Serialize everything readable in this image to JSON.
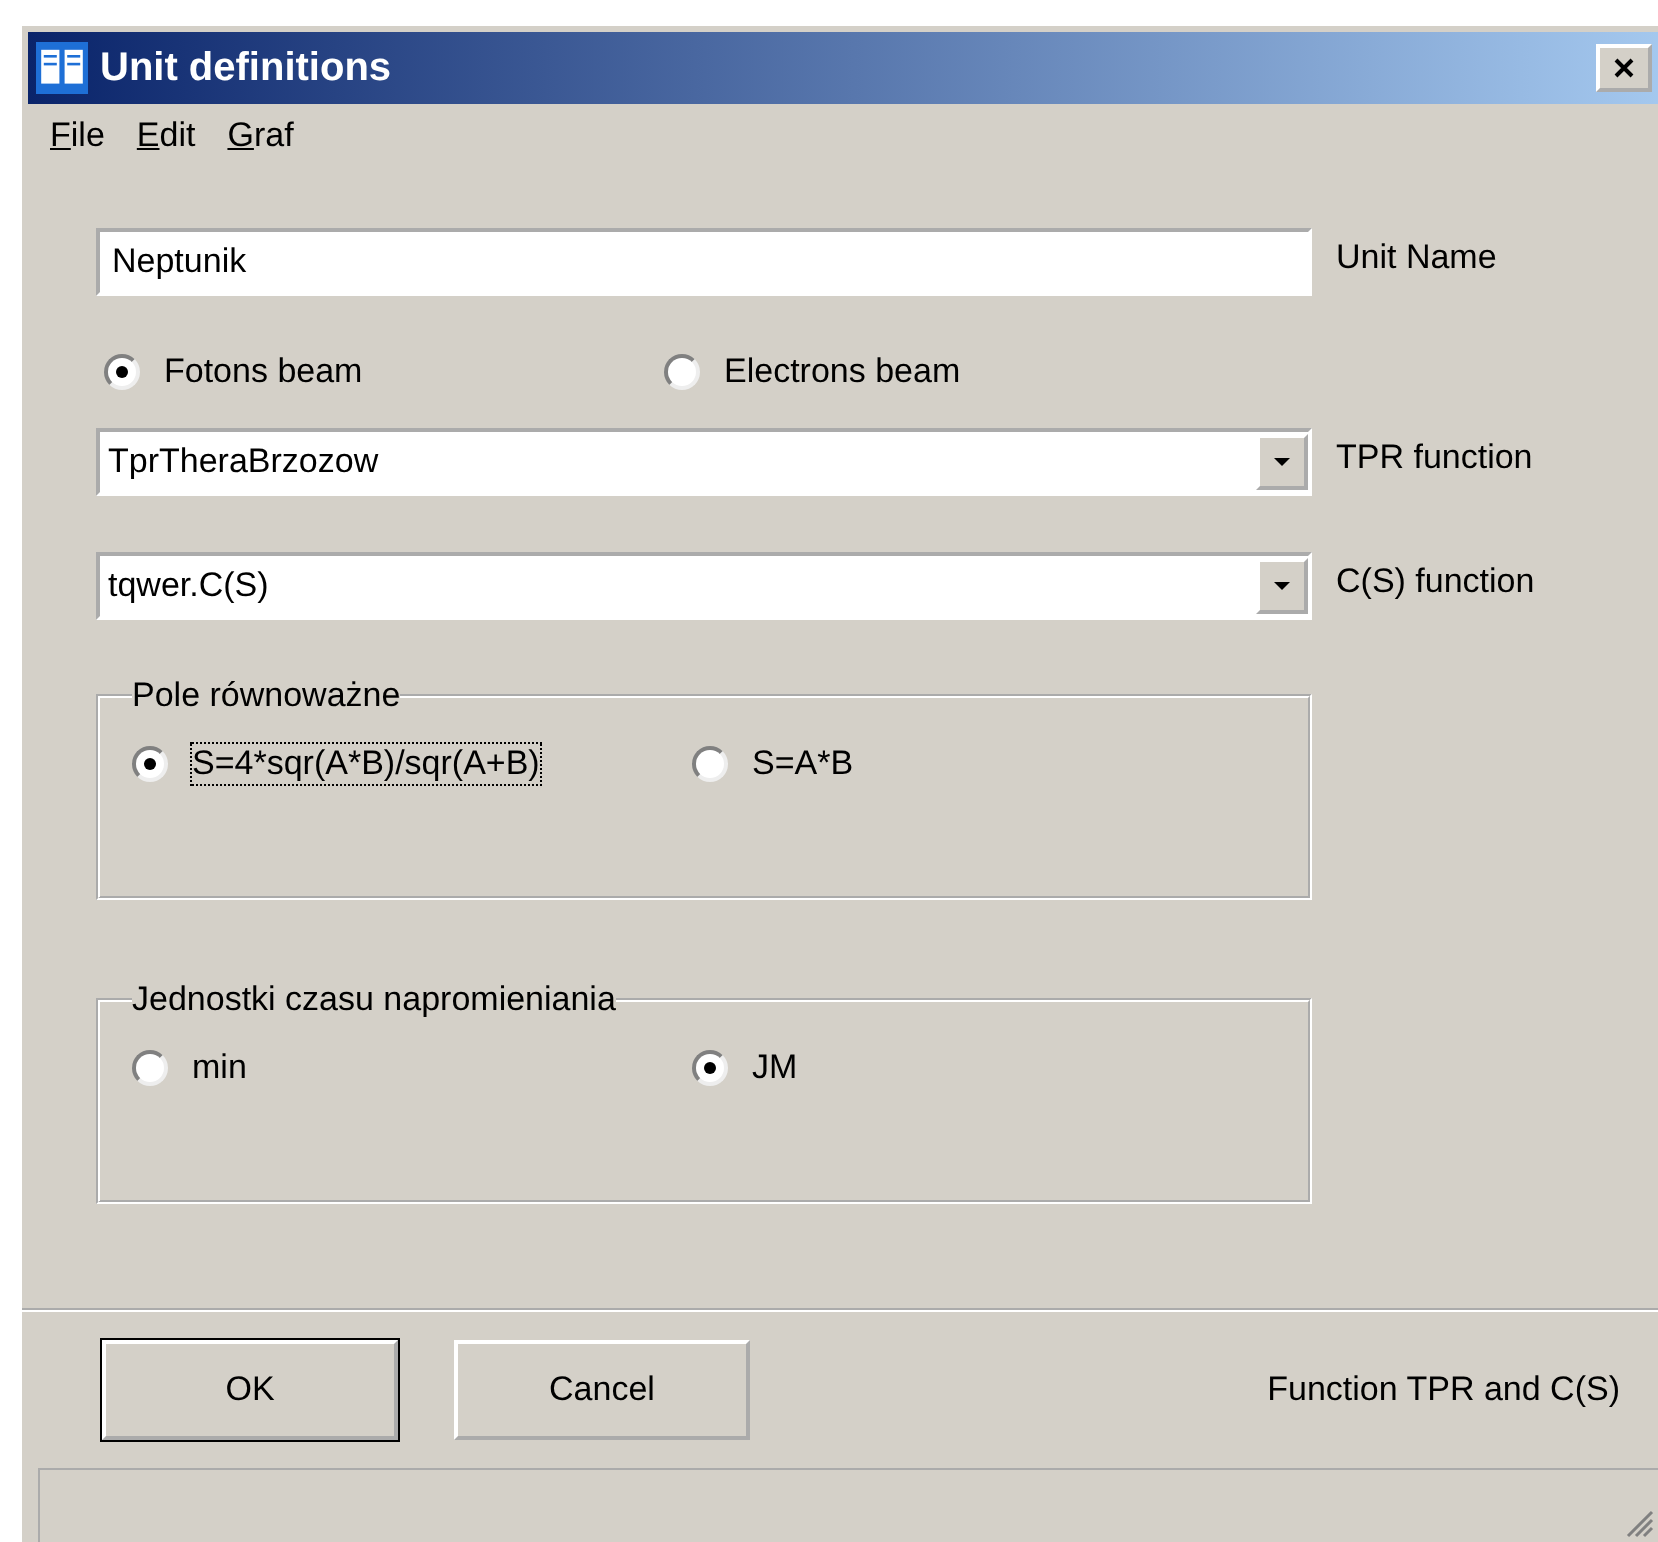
{
  "window": {
    "title": "Unit definitions"
  },
  "menu": [
    {
      "label": "File"
    },
    {
      "label": "Edit"
    },
    {
      "label": "Graf"
    }
  ],
  "unit_name": {
    "value": "Neptunik",
    "label": "Unit Name"
  },
  "beam": [
    {
      "label": "Fotons beam",
      "selected": true
    },
    {
      "label": "Electrons beam",
      "selected": false
    }
  ],
  "tpr": {
    "value": "TprTheraBrzozow",
    "label": "TPR function"
  },
  "cs": {
    "value": "tqwer.C(S)",
    "label": "C(S) function"
  },
  "groups": [
    {
      "title": "Pole równoważne",
      "options": [
        {
          "label": "S=4*sqr(A*B)/sqr(A+B)",
          "selected": true,
          "focused": true
        },
        {
          "label": "S=A*B",
          "selected": false,
          "focused": false
        }
      ]
    },
    {
      "title": "Jednostki czasu napromieniania",
      "options": [
        {
          "label": "min",
          "selected": false,
          "focused": false
        },
        {
          "label": "JM",
          "selected": true,
          "focused": false
        }
      ]
    }
  ],
  "buttons": [
    {
      "label": "OK",
      "default": true
    },
    {
      "label": "Cancel",
      "default": false
    }
  ],
  "footer_label": "Function TPR and C(S)"
}
